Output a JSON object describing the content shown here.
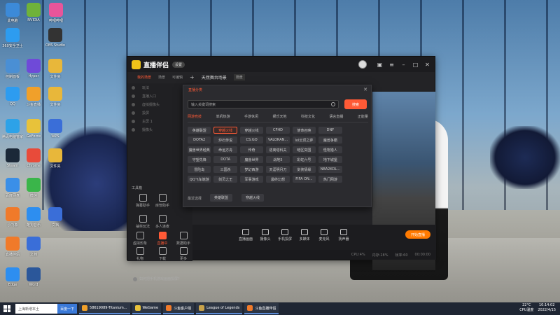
{
  "desktop": {
    "icons": [
      {
        "label": "此电脑",
        "color": "#3c8ad8"
      },
      {
        "label": "NVIDIA",
        "color": "#6fb23a"
      },
      {
        "label": "哔哩哔哩",
        "color": "#e8559a"
      },
      {
        "label": "360安全卫士",
        "color": "#2d9cf0"
      },
      {
        "label": "OBS Studio",
        "color": "#333333"
      },
      {
        "label": "控制面板",
        "color": "#4a8fd4"
      },
      {
        "label": "Hyper",
        "color": "#6f4ad8"
      },
      {
        "label": "文件夹",
        "color": "#e8b73a"
      },
      {
        "label": "QQ",
        "color": "#2d9cf0"
      },
      {
        "label": "斗鱼直播",
        "color": "#f0a02a"
      },
      {
        "label": "文件夹",
        "color": "#e8b73a"
      },
      {
        "label": "腾讯电脑管家",
        "color": "#2da2e8"
      },
      {
        "label": "GeForce",
        "color": "#e8c23a"
      },
      {
        "label": "WPS",
        "color": "#3a6ed8"
      },
      {
        "label": "Steam",
        "color": "#1b2838"
      },
      {
        "label": "Chrome",
        "color": "#e84b3a"
      },
      {
        "label": "文件夹",
        "color": "#e8b73a"
      },
      {
        "label": "百度网盘",
        "color": "#3a8fe8"
      },
      {
        "label": "微信",
        "color": "#3ab54a"
      },
      {
        "label": "小飞象",
        "color": "#f07a2a"
      },
      {
        "label": "酷狗音乐",
        "color": "#2d8ef0"
      },
      {
        "label": "文档",
        "color": "#3a6ed8"
      },
      {
        "label": "直播伴侣",
        "color": "#f07a2a"
      },
      {
        "label": "文档",
        "color": "#3a6ed8"
      },
      {
        "label": "Edge",
        "color": "#2d8ef0"
      },
      {
        "label": "Word",
        "color": "#2b579a"
      }
    ]
  },
  "app": {
    "title": "直播伴侣",
    "version_badge": "设置",
    "tabs": [
      "我的场景",
      "场景",
      "动态",
      "天然舞台",
      "场景"
    ],
    "scene_tabs": [
      {
        "label": "我的场景",
        "active": true
      },
      {
        "label": "场景",
        "active": false
      },
      {
        "label": "可编辑",
        "active": false
      }
    ],
    "scene_name": "天然舞台场景",
    "scene_tag": "场景",
    "sources": [
      "玩法",
      "直播入口",
      "虚拟摄像头",
      "投屏",
      "主屏 1",
      "摄像头"
    ],
    "tools_title": "工具箱",
    "tools": [
      {
        "label": "弹幕助手",
        "active": false
      },
      {
        "label": "房管助手",
        "active": false
      },
      {
        "label": "抽奖玩法",
        "active": false
      },
      {
        "label": "多人连麦",
        "active": false
      },
      {
        "label": "虚拟形象",
        "active": false
      },
      {
        "label": "直播中",
        "active": true
      },
      {
        "label": "数据助手",
        "active": false
      },
      {
        "label": "礼物",
        "active": false
      },
      {
        "label": "下载",
        "active": false
      },
      {
        "label": "更多",
        "active": false
      }
    ],
    "notice": "如何把手机游戏画面投屏？",
    "controls": [
      {
        "label": "直播画面"
      },
      {
        "label": "摄像头"
      },
      {
        "label": "手机投屏"
      },
      {
        "label": "多媒体"
      },
      {
        "label": "麦克风"
      },
      {
        "label": "扬声器"
      }
    ],
    "live_button": "开始直播",
    "status": [
      "CPU:4%",
      "内存:28%",
      "帧率:60",
      "00:00:00"
    ]
  },
  "popup": {
    "title": "直播分类",
    "search_placeholder": "输入关键词搜索",
    "search_button": "搜索",
    "categories": [
      {
        "label": "网游竞技",
        "active": true
      },
      {
        "label": "单机热游",
        "active": false
      },
      {
        "label": "手游休闲",
        "active": false
      },
      {
        "label": "娱乐天地",
        "active": false
      },
      {
        "label": "科技文化",
        "active": false
      },
      {
        "label": "语言直播",
        "active": false
      },
      {
        "label": "正能量",
        "active": false
      }
    ],
    "games": [
      {
        "label": "英雄联盟",
        "active": false
      },
      {
        "label": "穿越火线",
        "active": true
      },
      {
        "label": "穿越火线",
        "active": false
      },
      {
        "label": "CFHD",
        "active": false
      },
      {
        "label": "使命召唤",
        "active": false
      },
      {
        "label": "DNF",
        "active": false
      },
      {
        "label": "",
        "active": false
      },
      {
        "label": "DOTA2",
        "active": false
      },
      {
        "label": "炉石传说",
        "active": false
      },
      {
        "label": "CS:GO",
        "active": false
      },
      {
        "label": "VALORAN...",
        "active": false
      },
      {
        "label": "lol云顶之弈",
        "active": false
      },
      {
        "label": "魔兽争霸",
        "active": false
      },
      {
        "label": "",
        "active": false
      },
      {
        "label": "魔兽世界经典",
        "active": false
      },
      {
        "label": "命运方舟",
        "active": false
      },
      {
        "label": "传奇",
        "active": false
      },
      {
        "label": "逃离塔科夫",
        "active": false
      },
      {
        "label": "暗区突围",
        "active": false
      },
      {
        "label": "怪物猎人",
        "active": false
      },
      {
        "label": "",
        "active": false
      },
      {
        "label": "守望先锋",
        "active": false
      },
      {
        "label": "DOTA",
        "active": false
      },
      {
        "label": "魔兽世界",
        "active": false
      },
      {
        "label": "战地5",
        "active": false
      },
      {
        "label": "彩虹六号",
        "active": false
      },
      {
        "label": "地下城堡",
        "active": false
      },
      {
        "label": "",
        "active": false
      },
      {
        "label": "冒险岛",
        "active": false
      },
      {
        "label": "三国杀",
        "active": false
      },
      {
        "label": "梦幻西游",
        "active": false
      },
      {
        "label": "天涯明月刀",
        "active": false
      },
      {
        "label": "剑侠情缘",
        "active": false
      },
      {
        "label": "NBA2KOL...",
        "active": false
      },
      {
        "label": "",
        "active": false
      },
      {
        "label": "QQ飞车端游",
        "active": false
      },
      {
        "label": "剑灵之王",
        "active": false
      },
      {
        "label": "军事游戏",
        "active": false
      },
      {
        "label": "最终幻想",
        "active": false
      },
      {
        "label": "FIFA ON...",
        "active": false
      },
      {
        "label": "热门网游",
        "active": false
      },
      {
        "label": "",
        "active": false
      }
    ],
    "recent_label": "最近选择",
    "recent": [
      "英雄联盟",
      "穿越火线"
    ]
  },
  "taskbar": {
    "search_placeholder": "上海新增本土",
    "search_button": "百度一下",
    "apps": [
      {
        "label": "58619089-Titanium...",
        "color": "#f0a02a"
      },
      {
        "label": "WeGame",
        "color": "#e8c23a"
      },
      {
        "label": "斗鱼客户端",
        "color": "#f07a2a"
      },
      {
        "label": "League of Legends",
        "color": "#c8a24a"
      },
      {
        "label": "斗鱼直播伴侣",
        "color": "#f07a2a"
      }
    ],
    "weather": "22°C",
    "weather_desc": "CPU温度",
    "time": "10:14:02",
    "date": "2022/4/15"
  }
}
